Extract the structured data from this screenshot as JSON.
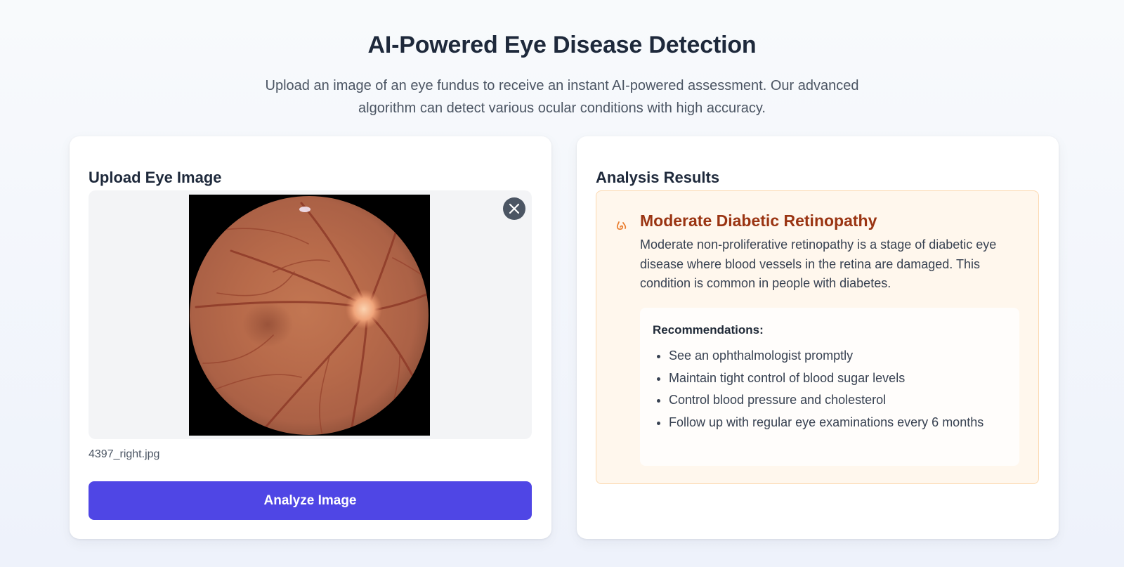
{
  "header": {
    "title": "AI-Powered Eye Disease Detection",
    "subtitle": "Upload an image of an eye fundus to receive an instant AI-powered assessment. Our advanced algorithm can detect various ocular conditions with high accuracy."
  },
  "upload_panel": {
    "heading": "Upload Eye Image",
    "file_name": "4397_right.jpg",
    "analyze_label": "Analyze Image",
    "remove_icon": "close-icon"
  },
  "results_panel": {
    "heading": "Analysis Results",
    "icon": "eye-drop-icon",
    "diagnosis_title": "Moderate Diabetic Retinopathy",
    "diagnosis_description": "Moderate non-proliferative retinopathy is a stage of diabetic eye disease where blood vessels in the retina are damaged. This condition is common in people with diabetes.",
    "recommendations_title": "Recommendations:",
    "recommendations": [
      "See an ophthalmologist promptly",
      "Maintain tight control of blood sugar levels",
      "Control blood pressure and cholesterol",
      "Follow up with regular eye examinations every 6 months"
    ]
  },
  "colors": {
    "accent": "#4f46e5",
    "warning_text": "#9a3412",
    "warning_background": "#fff7ed",
    "warning_border": "#fcd9b0"
  }
}
